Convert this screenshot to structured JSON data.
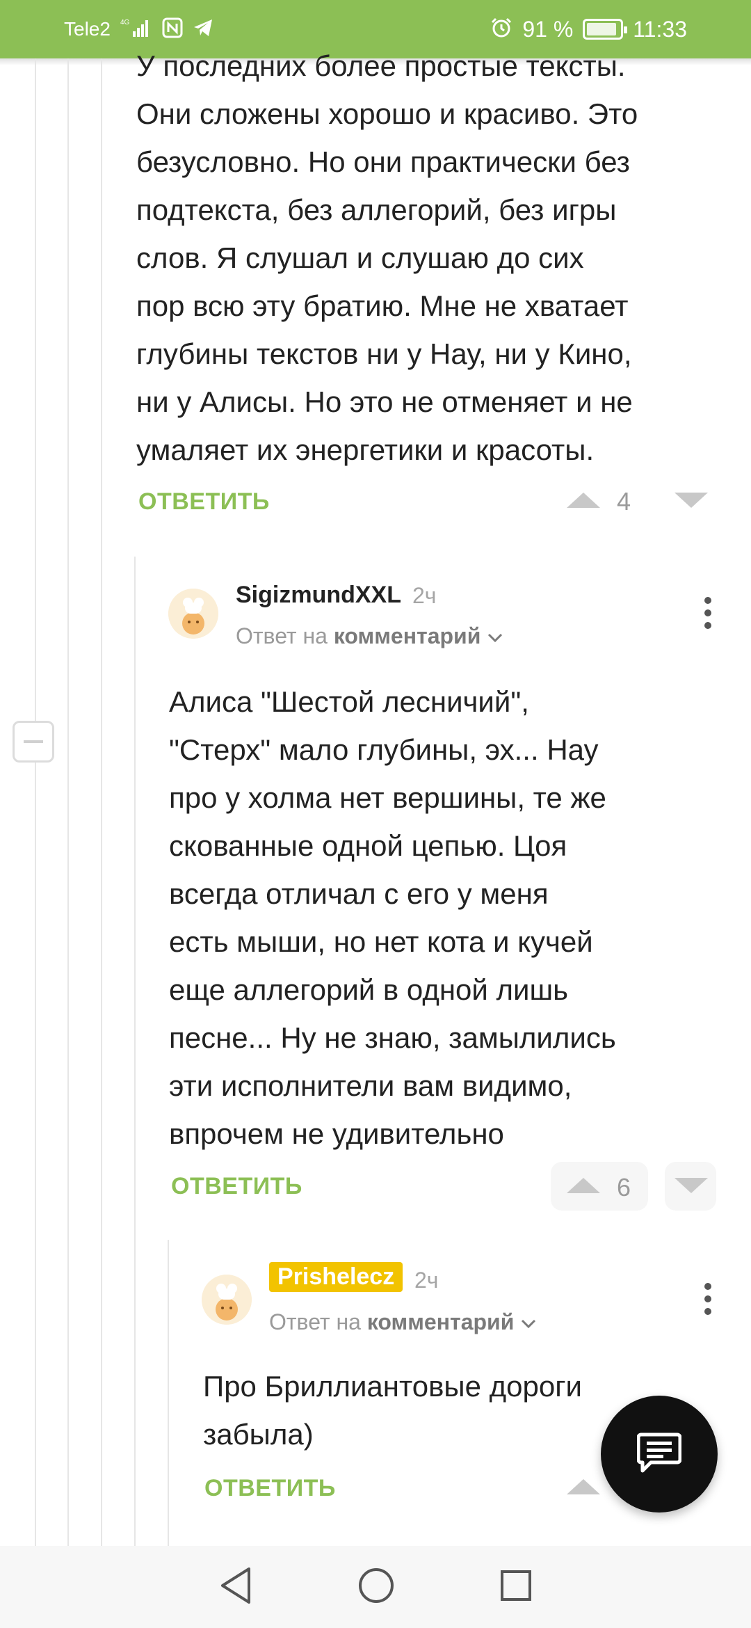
{
  "colors": {
    "accent": "#8cbf55"
  },
  "status_bar": {
    "carrier": "Tele2",
    "network": "4G",
    "battery": "91 %",
    "battery_level": 0.91,
    "time": "11:33",
    "icons": [
      "signal-icon",
      "nfc-icon",
      "telegram-icon",
      "alarm-icon",
      "battery-icon"
    ]
  },
  "comments": [
    {
      "text": "У последних более простые тексты.\nОни сложены хорошо и красиво. Это\nбезусловно. Но они практически без\nподтекста, без аллегорий, без игры\nслов. Я слушал и слушаю до сих\nпор всю эту братию. Мне не хватает\nглубины текстов ни у Нау, ни у Кино,\nни у Алисы. Но это не отменяет и не\nумаляет их энергетики и красоты.",
      "reply_label": "ОТВЕТИТЬ",
      "rating": "4"
    },
    {
      "author": "SigizmundXXL",
      "time": "2ч",
      "reply_to_prefix": "Ответ на",
      "reply_to_link": "комментарий",
      "text": "Алиса \"Шестой лесничий\",\n\"Стерх\" мало глубины, эх... Нау\nпро у холма нет вершины, те же\nскованные одной цепью. Цоя\nвсегда отличал с его у меня\nесть мыши, но нет кота и кучей\nеще аллегорий в одной лишь\nпесне... Ну не знаю, замылились\nэти исполнители вам видимо,\nвпрочем не удивительно",
      "reply_label": "ОТВЕТИТЬ",
      "rating": "6"
    },
    {
      "author": "Prishelecz",
      "time": "2ч",
      "reply_to_prefix": "Ответ на",
      "reply_to_link": "комментарий",
      "text": "Про Бриллиантовые дороги\nзабыла)",
      "reply_label": "ОТВЕТИТЬ"
    }
  ],
  "collapse_button": "minus-icon",
  "fab": {
    "icon": "comment-icon"
  },
  "nav_bar": {
    "icons": [
      "back-icon",
      "home-icon",
      "recents-icon"
    ]
  }
}
